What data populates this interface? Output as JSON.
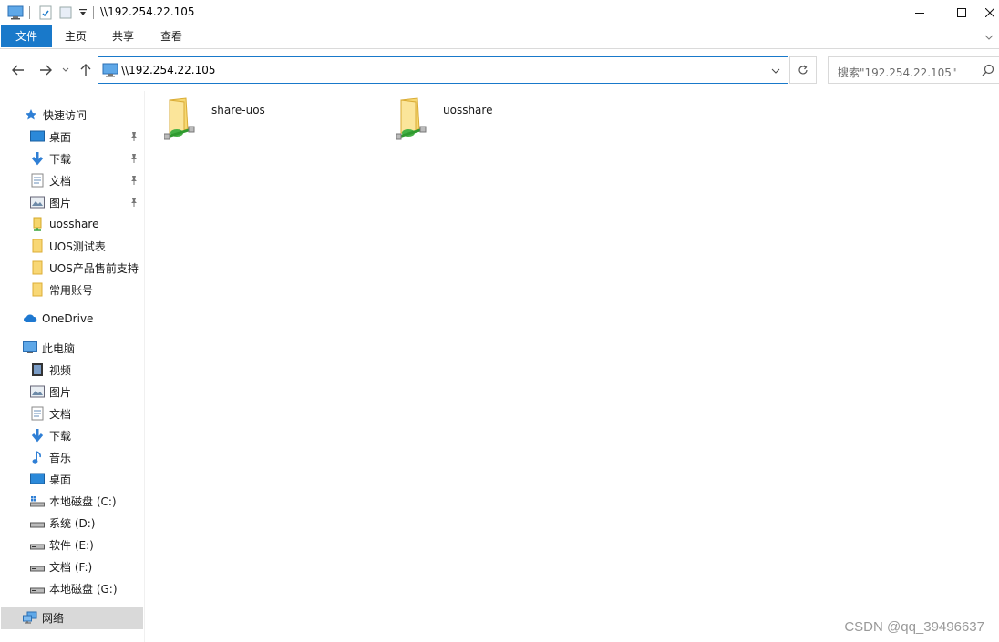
{
  "window": {
    "title": "\\\\192.254.22.105",
    "controls": {
      "minimize": "minimize-icon",
      "maximize": "maximize-icon",
      "close": "close-icon"
    }
  },
  "ribbon": {
    "tabs": [
      {
        "label": "文件",
        "active": true
      },
      {
        "label": "主页"
      },
      {
        "label": "共享"
      },
      {
        "label": "查看"
      }
    ]
  },
  "address": {
    "path": "\\\\192.254.22.105",
    "search_placeholder": "搜索\"192.254.22.105\""
  },
  "sidebar": {
    "quick_access": {
      "label": "快速访问",
      "items": [
        {
          "label": "桌面",
          "icon": "desktop-icon",
          "pinned": true
        },
        {
          "label": "下载",
          "icon": "download-icon",
          "pinned": true
        },
        {
          "label": "文档",
          "icon": "document-icon",
          "pinned": true
        },
        {
          "label": "图片",
          "icon": "picture-icon",
          "pinned": true
        },
        {
          "label": "uosshare",
          "icon": "network-share-icon",
          "pinned": false
        },
        {
          "label": "UOS测试表",
          "icon": "folder-icon",
          "pinned": false
        },
        {
          "label": "UOS产品售前支持",
          "icon": "folder-icon",
          "pinned": false
        },
        {
          "label": "常用账号",
          "icon": "folder-icon",
          "pinned": false
        }
      ]
    },
    "onedrive": {
      "label": "OneDrive"
    },
    "this_pc": {
      "label": "此电脑",
      "items": [
        {
          "label": "视频",
          "icon": "video-icon"
        },
        {
          "label": "图片",
          "icon": "picture-icon"
        },
        {
          "label": "文档",
          "icon": "document-icon"
        },
        {
          "label": "下载",
          "icon": "download-icon"
        },
        {
          "label": "音乐",
          "icon": "music-icon"
        },
        {
          "label": "桌面",
          "icon": "desktop-icon"
        },
        {
          "label": "本地磁盘 (C:)",
          "icon": "system-drive-icon"
        },
        {
          "label": "系统 (D:)",
          "icon": "drive-icon"
        },
        {
          "label": "软件 (E:)",
          "icon": "drive-icon"
        },
        {
          "label": "文档 (F:)",
          "icon": "drive-icon"
        },
        {
          "label": "本地磁盘 (G:)",
          "icon": "drive-icon"
        }
      ]
    },
    "network": {
      "label": "网络",
      "selected": true
    }
  },
  "content": {
    "folders": [
      {
        "name": "share-uos",
        "icon": "network-share-folder-icon"
      },
      {
        "name": "uosshare",
        "icon": "network-share-folder-icon"
      }
    ]
  },
  "watermark": "CSDN @qq_39496637"
}
